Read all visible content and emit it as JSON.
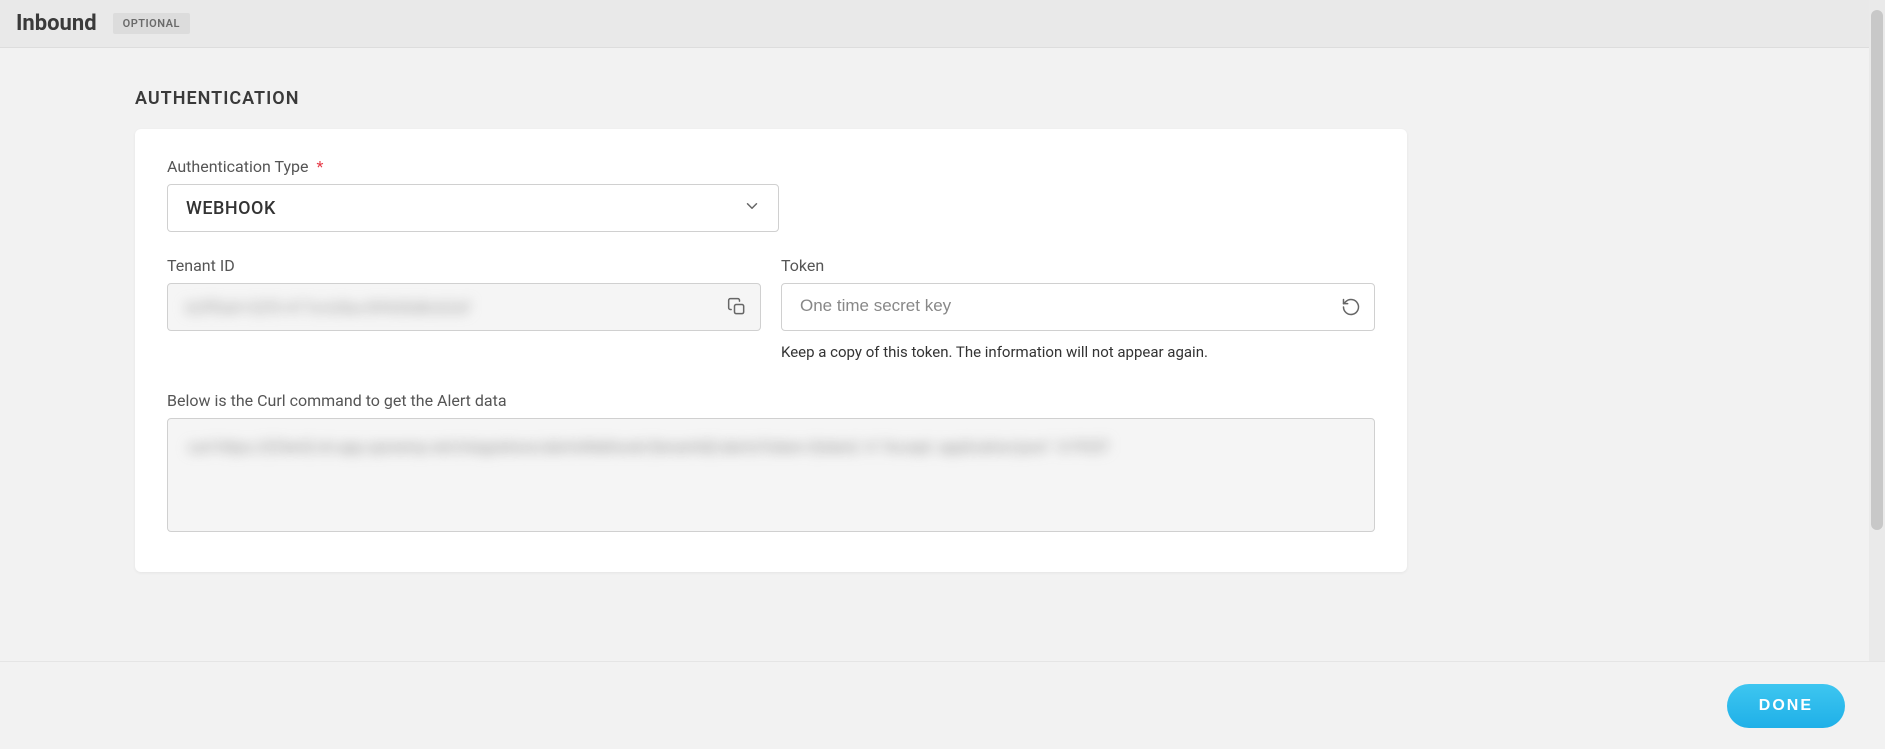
{
  "header": {
    "title": "Inbound",
    "badge": "OPTIONAL"
  },
  "section": {
    "title": "AUTHENTICATION"
  },
  "fields": {
    "authType": {
      "label": "Authentication Type",
      "required": true,
      "value": "WEBHOOK"
    },
    "tenantId": {
      "label": "Tenant ID",
      "value": "b2ff0aH-S2f3-477a-b3ba-899d5d8cb2ef"
    },
    "token": {
      "label": "Token",
      "placeholder": "One time secret key",
      "helper": "Keep a copy of this token. The information will not appear again."
    },
    "curl": {
      "label": "Below is the Curl command to get the Alert data",
      "value": "curl https://{Client}.int.app.opsramp.net/integrations/alertsWebhook/{tenantId}/alerts?token={token} -H \"Accept: application/json\" -X POST"
    }
  },
  "footer": {
    "done": "DONE"
  }
}
